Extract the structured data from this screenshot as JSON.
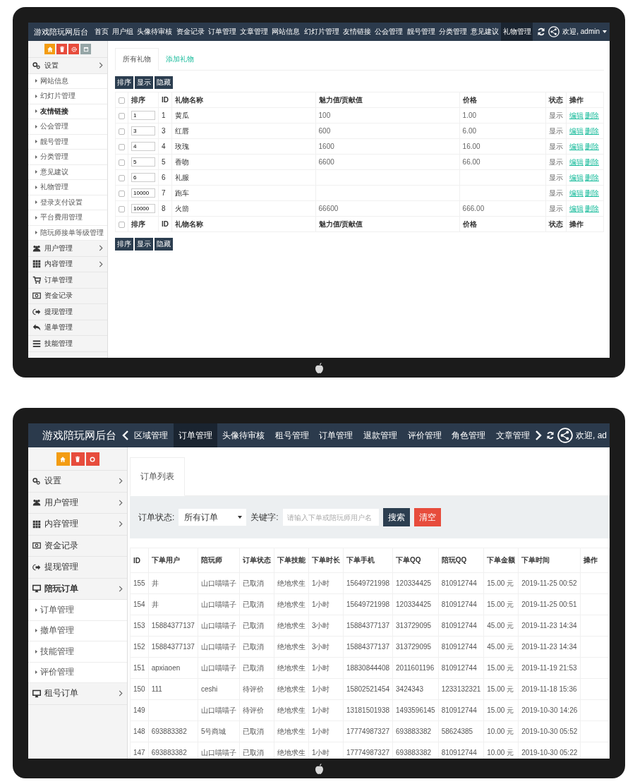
{
  "gift_admin": {
    "header": {
      "brand": "游戏陪玩网后台",
      "scroll_arrows": false,
      "nav": [
        {
          "label": "首页",
          "selected": false
        },
        {
          "label": "用户组",
          "selected": false
        },
        {
          "label": "头像待审核",
          "selected": false
        },
        {
          "label": "资金记录",
          "selected": false
        },
        {
          "label": "订单管理",
          "selected": false
        },
        {
          "label": "文章管理",
          "selected": false
        },
        {
          "label": "网站信息",
          "selected": false
        },
        {
          "label": "幻灯片管理",
          "selected": false
        },
        {
          "label": "友情链接",
          "selected": false
        },
        {
          "label": "公会管理",
          "selected": false
        },
        {
          "label": "靓号管理",
          "selected": false
        },
        {
          "label": "分类管理",
          "selected": false
        },
        {
          "label": "意见建议",
          "selected": false
        },
        {
          "label": "礼物管理",
          "selected": true
        }
      ],
      "greeting": "欢迎, admin",
      "menu_caret": true
    },
    "sidebar": {
      "quick_buttons": [
        {
          "kind": "home",
          "color": "#f39c12"
        },
        {
          "kind": "trash",
          "color": "#e74c3c"
        },
        {
          "kind": "gear",
          "color": "#e74c3c"
        },
        {
          "kind": "square",
          "color": "#95a5a6"
        }
      ],
      "items": [
        {
          "label": "设置",
          "kind": "settings",
          "selected": false,
          "has_submenu": true,
          "children": [
            {
              "label": "网站信息",
              "selected": false
            },
            {
              "label": "幻灯片管理",
              "selected": false
            },
            {
              "label": "友情链接",
              "selected": true
            },
            {
              "label": "公会管理",
              "selected": false
            },
            {
              "label": "靓号管理",
              "selected": false
            },
            {
              "label": "分类管理",
              "selected": false
            },
            {
              "label": "意见建议",
              "selected": false
            },
            {
              "label": "礼物管理",
              "selected": false
            },
            {
              "label": "登录支付设置",
              "selected": false
            },
            {
              "label": "平台费用管理",
              "selected": false
            },
            {
              "label": "陪玩师接单等级管理",
              "selected": false
            }
          ]
        },
        {
          "label": "用户管理",
          "kind": "users",
          "selected": false,
          "has_submenu": true
        },
        {
          "label": "内容管理",
          "kind": "grid",
          "selected": false,
          "has_submenu": true
        },
        {
          "label": "订单管理",
          "kind": "cart",
          "selected": false,
          "has_submenu": false
        },
        {
          "label": "资金记录",
          "kind": "money",
          "selected": false,
          "has_submenu": false
        },
        {
          "label": "提现管理",
          "kind": "withdraw",
          "selected": false,
          "has_submenu": false
        },
        {
          "label": "退单管理",
          "kind": "undo",
          "selected": false,
          "has_submenu": false
        },
        {
          "label": "技能管理",
          "kind": "list",
          "selected": false,
          "has_submenu": false
        }
      ]
    },
    "tabs": [
      {
        "label": "所有礼物",
        "selected": true
      },
      {
        "label": "添加礼物",
        "selected": false
      }
    ],
    "action_buttons": [
      "排序",
      "显示",
      "隐藏"
    ],
    "table": {
      "select_all_checked": false,
      "columns": [
        "排序",
        "ID",
        "礼物名称",
        "魅力值/贡献值",
        "价格",
        "状态",
        "操作"
      ],
      "rows": [
        {
          "checked": false,
          "sort": "1",
          "id": "1",
          "name": "黄瓜",
          "charm": "100",
          "price": "1.00",
          "status": "显示",
          "actions": [
            "编辑",
            "删除"
          ]
        },
        {
          "checked": false,
          "sort": "3",
          "id": "3",
          "name": "红唇",
          "charm": "600",
          "price": "6.00",
          "status": "显示",
          "actions": [
            "编辑",
            "删除"
          ]
        },
        {
          "checked": false,
          "sort": "4",
          "id": "4",
          "name": "玫瑰",
          "charm": "1600",
          "price": "16.00",
          "status": "显示",
          "actions": [
            "编辑",
            "删除"
          ]
        },
        {
          "checked": false,
          "sort": "5",
          "id": "5",
          "name": "香吻",
          "charm": "6600",
          "price": "66.00",
          "status": "显示",
          "actions": [
            "编辑",
            "删除"
          ]
        },
        {
          "checked": false,
          "sort": "6",
          "id": "6",
          "name": "礼服",
          "status": "显示",
          "actions": [
            "编辑",
            "删除"
          ]
        },
        {
          "checked": false,
          "sort": "10000",
          "id": "7",
          "name": "跑车",
          "status": "显示",
          "actions": [
            "编辑",
            "删除"
          ]
        },
        {
          "checked": false,
          "sort": "10000",
          "id": "8",
          "name": "火箭",
          "charm": "66600",
          "price": "666.00",
          "status": "显示",
          "actions": [
            "编辑",
            "删除"
          ]
        }
      ],
      "footer_select_all_checked": false,
      "footer_columns": [
        "排序",
        "ID",
        "礼物名称",
        "魅力值/贡献值",
        "价格",
        "状态",
        "操作"
      ]
    },
    "bottom_action_buttons": [
      "排序",
      "显示",
      "隐藏"
    ]
  },
  "order_admin": {
    "header": {
      "brand": "游戏陪玩网后台",
      "scroll_arrows": true,
      "nav": [
        {
          "label": "区域管理",
          "selected": false
        },
        {
          "label": "订单管理",
          "selected": true
        },
        {
          "label": "头像待审核",
          "selected": false
        },
        {
          "label": "租号管理",
          "selected": false
        },
        {
          "label": "订单管理",
          "selected": false
        },
        {
          "label": "退款管理",
          "selected": false
        },
        {
          "label": "评价管理",
          "selected": false
        },
        {
          "label": "角色管理",
          "selected": false
        },
        {
          "label": "文章管理",
          "selected": false
        }
      ],
      "greeting": "欢迎, ad",
      "menu_caret": false
    },
    "sidebar": {
      "quick_buttons": [
        {
          "kind": "home",
          "color": "#f39c12"
        },
        {
          "kind": "trash",
          "color": "#e74c3c"
        },
        {
          "kind": "ring",
          "color": "#e74c3c"
        }
      ],
      "items": [
        {
          "label": "设置",
          "kind": "settings",
          "selected": false,
          "has_submenu": true
        },
        {
          "label": "用户管理",
          "kind": "users",
          "selected": false,
          "has_submenu": true
        },
        {
          "label": "内容管理",
          "kind": "grid",
          "selected": false,
          "has_submenu": true
        },
        {
          "label": "资金记录",
          "kind": "money",
          "selected": false,
          "has_submenu": false
        },
        {
          "label": "提现管理",
          "kind": "withdraw",
          "selected": false,
          "has_submenu": false
        },
        {
          "label": "陪玩订单",
          "kind": "monitor",
          "selected": true,
          "has_submenu": true,
          "children": [
            {
              "label": "订单管理",
              "selected": false
            },
            {
              "label": "撤单管理",
              "selected": false
            },
            {
              "label": "技能管理",
              "selected": false
            },
            {
              "label": "评价管理",
              "selected": false
            }
          ]
        },
        {
          "label": "租号订单",
          "kind": "monitor",
          "selected": false,
          "has_submenu": true
        }
      ]
    },
    "tabs": [
      {
        "label": "订单列表",
        "selected": true
      }
    ],
    "filter": {
      "status_label": "订单状态:",
      "status_value": "所有订单",
      "keyword_label": "关键字:",
      "keyword_placeholder": "请输入下单或陪玩师用户名",
      "buttons": [
        {
          "label": "搜索",
          "kind": "primary"
        },
        {
          "label": "清空",
          "kind": "danger"
        }
      ]
    },
    "table": {
      "columns": [
        "ID",
        "下单用户",
        "陪玩师",
        "订单状态",
        "下单技能",
        "下单时长",
        "下单手机",
        "下单QQ",
        "陪玩QQ",
        "下单金额",
        "下单时间",
        "操作"
      ],
      "rows": [
        {
          "id": "155",
          "user": "井",
          "companion": "山口喵喵子",
          "status": "已取消",
          "skill": "绝地求生",
          "duration": "1小时",
          "phone": "15649721998",
          "qq": "120334425",
          "companion_qq": "810912744",
          "amount": "15.00 元",
          "time": "2019-11-25 00:52"
        },
        {
          "id": "154",
          "user": "井",
          "companion": "山口喵喵子",
          "status": "已取消",
          "skill": "绝地求生",
          "duration": "1小时",
          "phone": "15649721998",
          "qq": "120334425",
          "companion_qq": "810912744",
          "amount": "15.00 元",
          "time": "2019-11-25 00:51"
        },
        {
          "id": "153",
          "user": "15884377137",
          "companion": "山口喵喵子",
          "status": "已取消",
          "skill": "绝地求生",
          "duration": "3小时",
          "phone": "15884377137",
          "qq": "313729095",
          "companion_qq": "810912744",
          "amount": "45.00 元",
          "time": "2019-11-23 14:34"
        },
        {
          "id": "152",
          "user": "15884377137",
          "companion": "山口喵喵子",
          "status": "已取消",
          "skill": "绝地求生",
          "duration": "3小时",
          "phone": "15884377137",
          "qq": "313729095",
          "companion_qq": "810912744",
          "amount": "45.00 元",
          "time": "2019-11-23 14:34"
        },
        {
          "id": "151",
          "user": "apxiaoen",
          "companion": "山口喵喵子",
          "status": "已取消",
          "skill": "绝地求生",
          "duration": "1小时",
          "phone": "18830844408",
          "qq": "2011601196",
          "companion_qq": "810912744",
          "amount": "15.00 元",
          "time": "2019-11-19 21:53"
        },
        {
          "id": "150",
          "user": "111",
          "companion": "ceshi",
          "status": "待评价",
          "skill": "绝地求生",
          "duration": "1小时",
          "phone": "15802521454",
          "qq": "3424343",
          "companion_qq": "1233132321",
          "amount": "15.00 元",
          "time": "2019-11-18 15:36"
        },
        {
          "id": "149",
          "companion": "山口喵喵子",
          "status": "待评价",
          "skill": "绝地求生",
          "duration": "1小时",
          "phone": "13181501938",
          "qq": "1493596145",
          "companion_qq": "810912744",
          "amount": "15.00 元",
          "time": "2019-10-30 14:26"
        },
        {
          "id": "148",
          "user": "693883382",
          "companion": "5号商城",
          "status": "已取消",
          "skill": "绝地求生",
          "duration": "1小时",
          "phone": "17774987327",
          "qq": "693883382",
          "companion_qq": "58624385",
          "amount": "10.00 元",
          "time": "2019-10-30 05:52"
        },
        {
          "id": "147",
          "user": "693883382",
          "companion": "山口喵喵子",
          "status": "已取消",
          "skill": "绝地求生",
          "duration": "1小时",
          "phone": "17774987327",
          "qq": "693883382",
          "companion_qq": "810912744",
          "amount": "10.00 元",
          "time": "2019-10-30 05:22"
        }
      ]
    }
  }
}
